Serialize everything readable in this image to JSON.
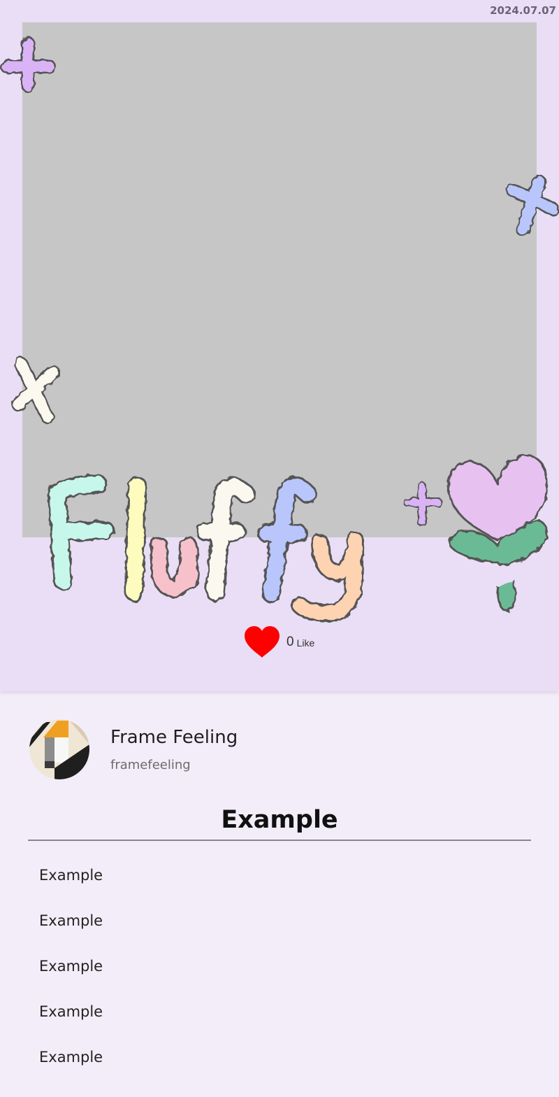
{
  "post": {
    "date": "2024.07.07",
    "sticker_text": "Fluffy",
    "likes": {
      "count": "0",
      "label": "Like"
    }
  },
  "profile": {
    "name": "Frame Feeling",
    "handle": "framefeeling"
  },
  "section": {
    "title": "Example",
    "items": [
      "Example",
      "Example",
      "Example",
      "Example",
      "Example"
    ]
  },
  "colors": {
    "frame_bg": "#e9def5",
    "page_bg": "#f3edf9",
    "photo_placeholder": "#c6c6c6",
    "heart": "#ff0000"
  }
}
